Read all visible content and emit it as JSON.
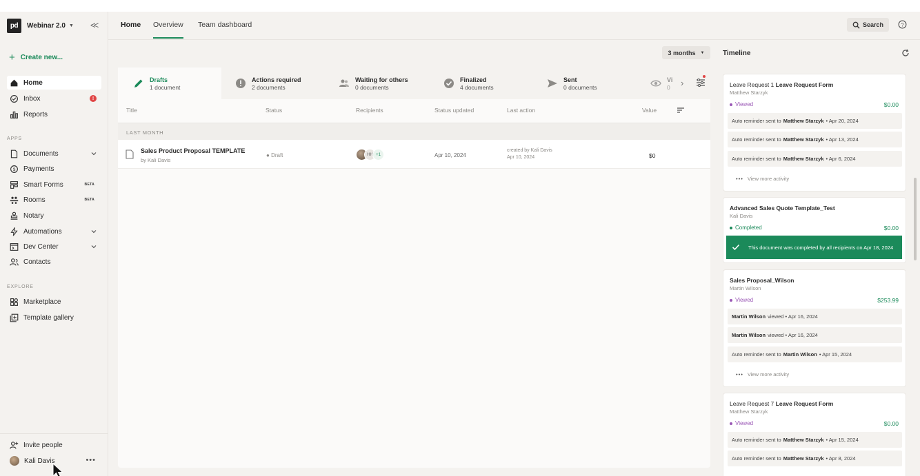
{
  "workspace": {
    "logo": "pd",
    "name": "Webinar 2.0"
  },
  "sidebar": {
    "create_label": "Create new...",
    "nav": [
      {
        "label": "Home",
        "icon": "home-icon",
        "active": true
      },
      {
        "label": "Inbox",
        "icon": "inbox-icon",
        "badge": "!"
      },
      {
        "label": "Reports",
        "icon": "reports-icon"
      }
    ],
    "apps_title": "APPS",
    "apps": [
      {
        "label": "Documents",
        "icon": "document-icon",
        "chevron": true
      },
      {
        "label": "Payments",
        "icon": "dollar-icon"
      },
      {
        "label": "Smart Forms",
        "icon": "form-icon",
        "badge": "BETA"
      },
      {
        "label": "Rooms",
        "icon": "rooms-icon",
        "badge": "BETA"
      },
      {
        "label": "Notary",
        "icon": "stamp-icon"
      },
      {
        "label": "Automations",
        "icon": "lightning-icon",
        "chevron": true
      },
      {
        "label": "Dev Center",
        "icon": "code-icon",
        "chevron": true
      },
      {
        "label": "Contacts",
        "icon": "contacts-icon"
      }
    ],
    "explore_title": "EXPLORE",
    "explore": [
      {
        "label": "Marketplace",
        "icon": "marketplace-icon"
      },
      {
        "label": "Template gallery",
        "icon": "template-icon"
      }
    ],
    "invite_label": "Invite people",
    "user_name": "Kali Davis",
    "more": "•••"
  },
  "topbar": {
    "tabs": [
      "Home",
      "Overview",
      "Team dashboard"
    ],
    "search_label": "Search"
  },
  "filter": {
    "period": "3 months"
  },
  "status_tabs": [
    {
      "label": "Drafts",
      "count": "1 document"
    },
    {
      "label": "Actions required",
      "count": "2 documents"
    },
    {
      "label": "Waiting for others",
      "count": "0 documents"
    },
    {
      "label": "Finalized",
      "count": "4 documents"
    },
    {
      "label": "Sent",
      "count": "0 documents"
    },
    {
      "label": "Vi",
      "count": "0"
    }
  ],
  "table": {
    "columns": [
      "Title",
      "Status",
      "Recipients",
      "Status updated",
      "Last action",
      "Value"
    ],
    "group": "LAST MONTH",
    "rows": [
      {
        "title": "Sales Product Proposal TEMPLATE",
        "owner": "by Kali Davis",
        "status": "Draft",
        "recipient_initials": "HH",
        "recipient_more": "+1",
        "updated": "Apr 10, 2024",
        "last_action_1": "created by Kali Davis",
        "last_action_2": "Apr 10, 2024",
        "value": "$0"
      }
    ]
  },
  "timeline": {
    "title": "Timeline",
    "view_more": "View more activity",
    "cards": [
      {
        "title_a": "Leave Request 1",
        "title_b": "Leave Request Form",
        "sub": "Matthew Starzyk",
        "status": "Viewed",
        "amount": "$0.00",
        "acts": [
          {
            "pre": "Auto reminder sent to",
            "who": "Matthew Starzyk",
            "post": "• Apr 20, 2024"
          },
          {
            "pre": "Auto reminder sent to",
            "who": "Matthew Starzyk",
            "post": "• Apr 13, 2024"
          },
          {
            "pre": "Auto reminder sent to",
            "who": "Matthew Starzyk",
            "post": "• Apr 6, 2024"
          }
        ]
      },
      {
        "title_a": "",
        "title_b": "Advanced Sales Quote Template_Test",
        "sub": "Kali Davis",
        "status": "Completed",
        "amount": "$0.00",
        "complete_msg": "This document was completed by all recipients on Apr 18, 2024"
      },
      {
        "title_a": "",
        "title_b": "Sales Proposal_Wilson",
        "sub": "Martin Wilson",
        "status": "Viewed",
        "amount": "$253.99",
        "acts": [
          {
            "pre": "",
            "who": "Martin Wilson",
            "post": "viewed • Apr 16, 2024"
          },
          {
            "pre": "",
            "who": "Martin Wilson",
            "post": "viewed • Apr 16, 2024"
          },
          {
            "pre": "Auto reminder sent to",
            "who": "Martin Wilson",
            "post": "• Apr 15, 2024"
          }
        ]
      },
      {
        "title_a": "Leave Request 7",
        "title_b": "Leave Request Form",
        "sub": "Matthew Starzyk",
        "status": "Viewed",
        "amount": "$0.00",
        "acts": [
          {
            "pre": "Auto reminder sent to",
            "who": "Matthew Starzyk",
            "post": "• Apr 15, 2024"
          },
          {
            "pre": "Auto reminder sent to",
            "who": "Matthew Starzyk",
            "post": "• Apr 8, 2024"
          }
        ]
      }
    ]
  },
  "colors": {
    "accent": "#1b8a5a",
    "viewed": "#9b59b6",
    "completed": "#1b8a5a",
    "badge": "#e04545"
  }
}
